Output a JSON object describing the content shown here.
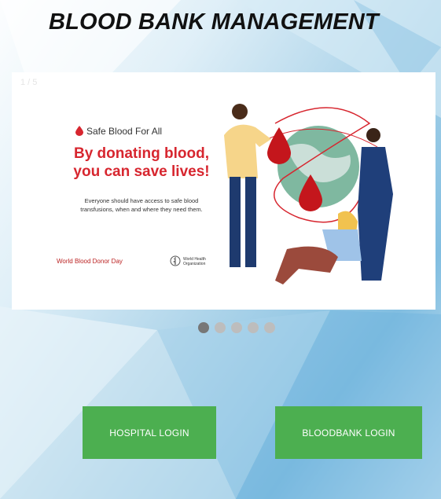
{
  "page": {
    "title": "BLOOD BANK MANAGEMENT"
  },
  "slider": {
    "counter": "1 / 5",
    "slide": {
      "tagline": "Safe Blood For All",
      "headline_line1": "By donating blood,",
      "headline_line2": "you can save lives!",
      "subtext_line1": "Everyone should have access to safe blood",
      "subtext_line2": "transfusions, when and where they need them.",
      "partner_left": "World Blood Donor Day",
      "partner_right_line1": "World Health",
      "partner_right_line2": "Organization"
    },
    "dots": [
      {
        "active": true
      },
      {
        "active": false
      },
      {
        "active": false
      },
      {
        "active": false
      },
      {
        "active": false
      }
    ]
  },
  "buttons": {
    "hospital_login": "HOSPITAL LOGIN",
    "bloodbank_login": "BLOODBANK LOGIN"
  },
  "colors": {
    "button_green": "#4caf50",
    "headline_red": "#d7262f",
    "dot_active": "#777777",
    "dot_inactive": "#bdbdbd"
  }
}
